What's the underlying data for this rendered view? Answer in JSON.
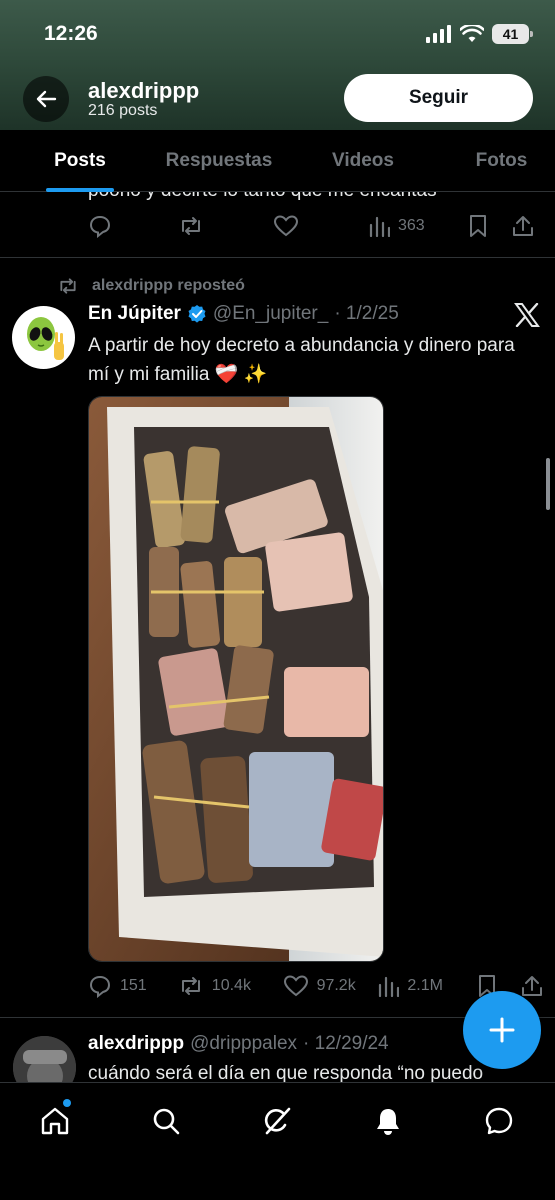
{
  "status": {
    "time": "12:26",
    "battery": "41"
  },
  "header": {
    "profile_name": "alexdrippp",
    "post_count": "216 posts",
    "follow_label": "Seguir"
  },
  "tabs": [
    {
      "label": "Posts"
    },
    {
      "label": "Respuestas"
    },
    {
      "label": "Videos"
    },
    {
      "label": "Fotos"
    }
  ],
  "prev_post": {
    "text_fragment": "poono y decirte lo tanto que me encantas",
    "views": "363"
  },
  "repost": {
    "label": "alexdrippp reposteó",
    "author_name": "En Júpiter",
    "handle": "@En_jupiter_",
    "date": "· 1/2/25",
    "text": "A partir de hoy decreto a abundancia y dinero para mí y mi familia ❤️‍🩹 ✨",
    "replies": "151",
    "reposts": "10.4k",
    "likes": "97.2k",
    "views": "2.1M"
  },
  "next_post": {
    "author_name": "alexdrippp",
    "handle": "@dripppalex",
    "date": "· 12/29/24",
    "text": "cuándo será el día en que responda “no puedo"
  },
  "colors": {
    "accent": "#1d9bf0",
    "background": "#000000",
    "muted": "#71767b"
  }
}
